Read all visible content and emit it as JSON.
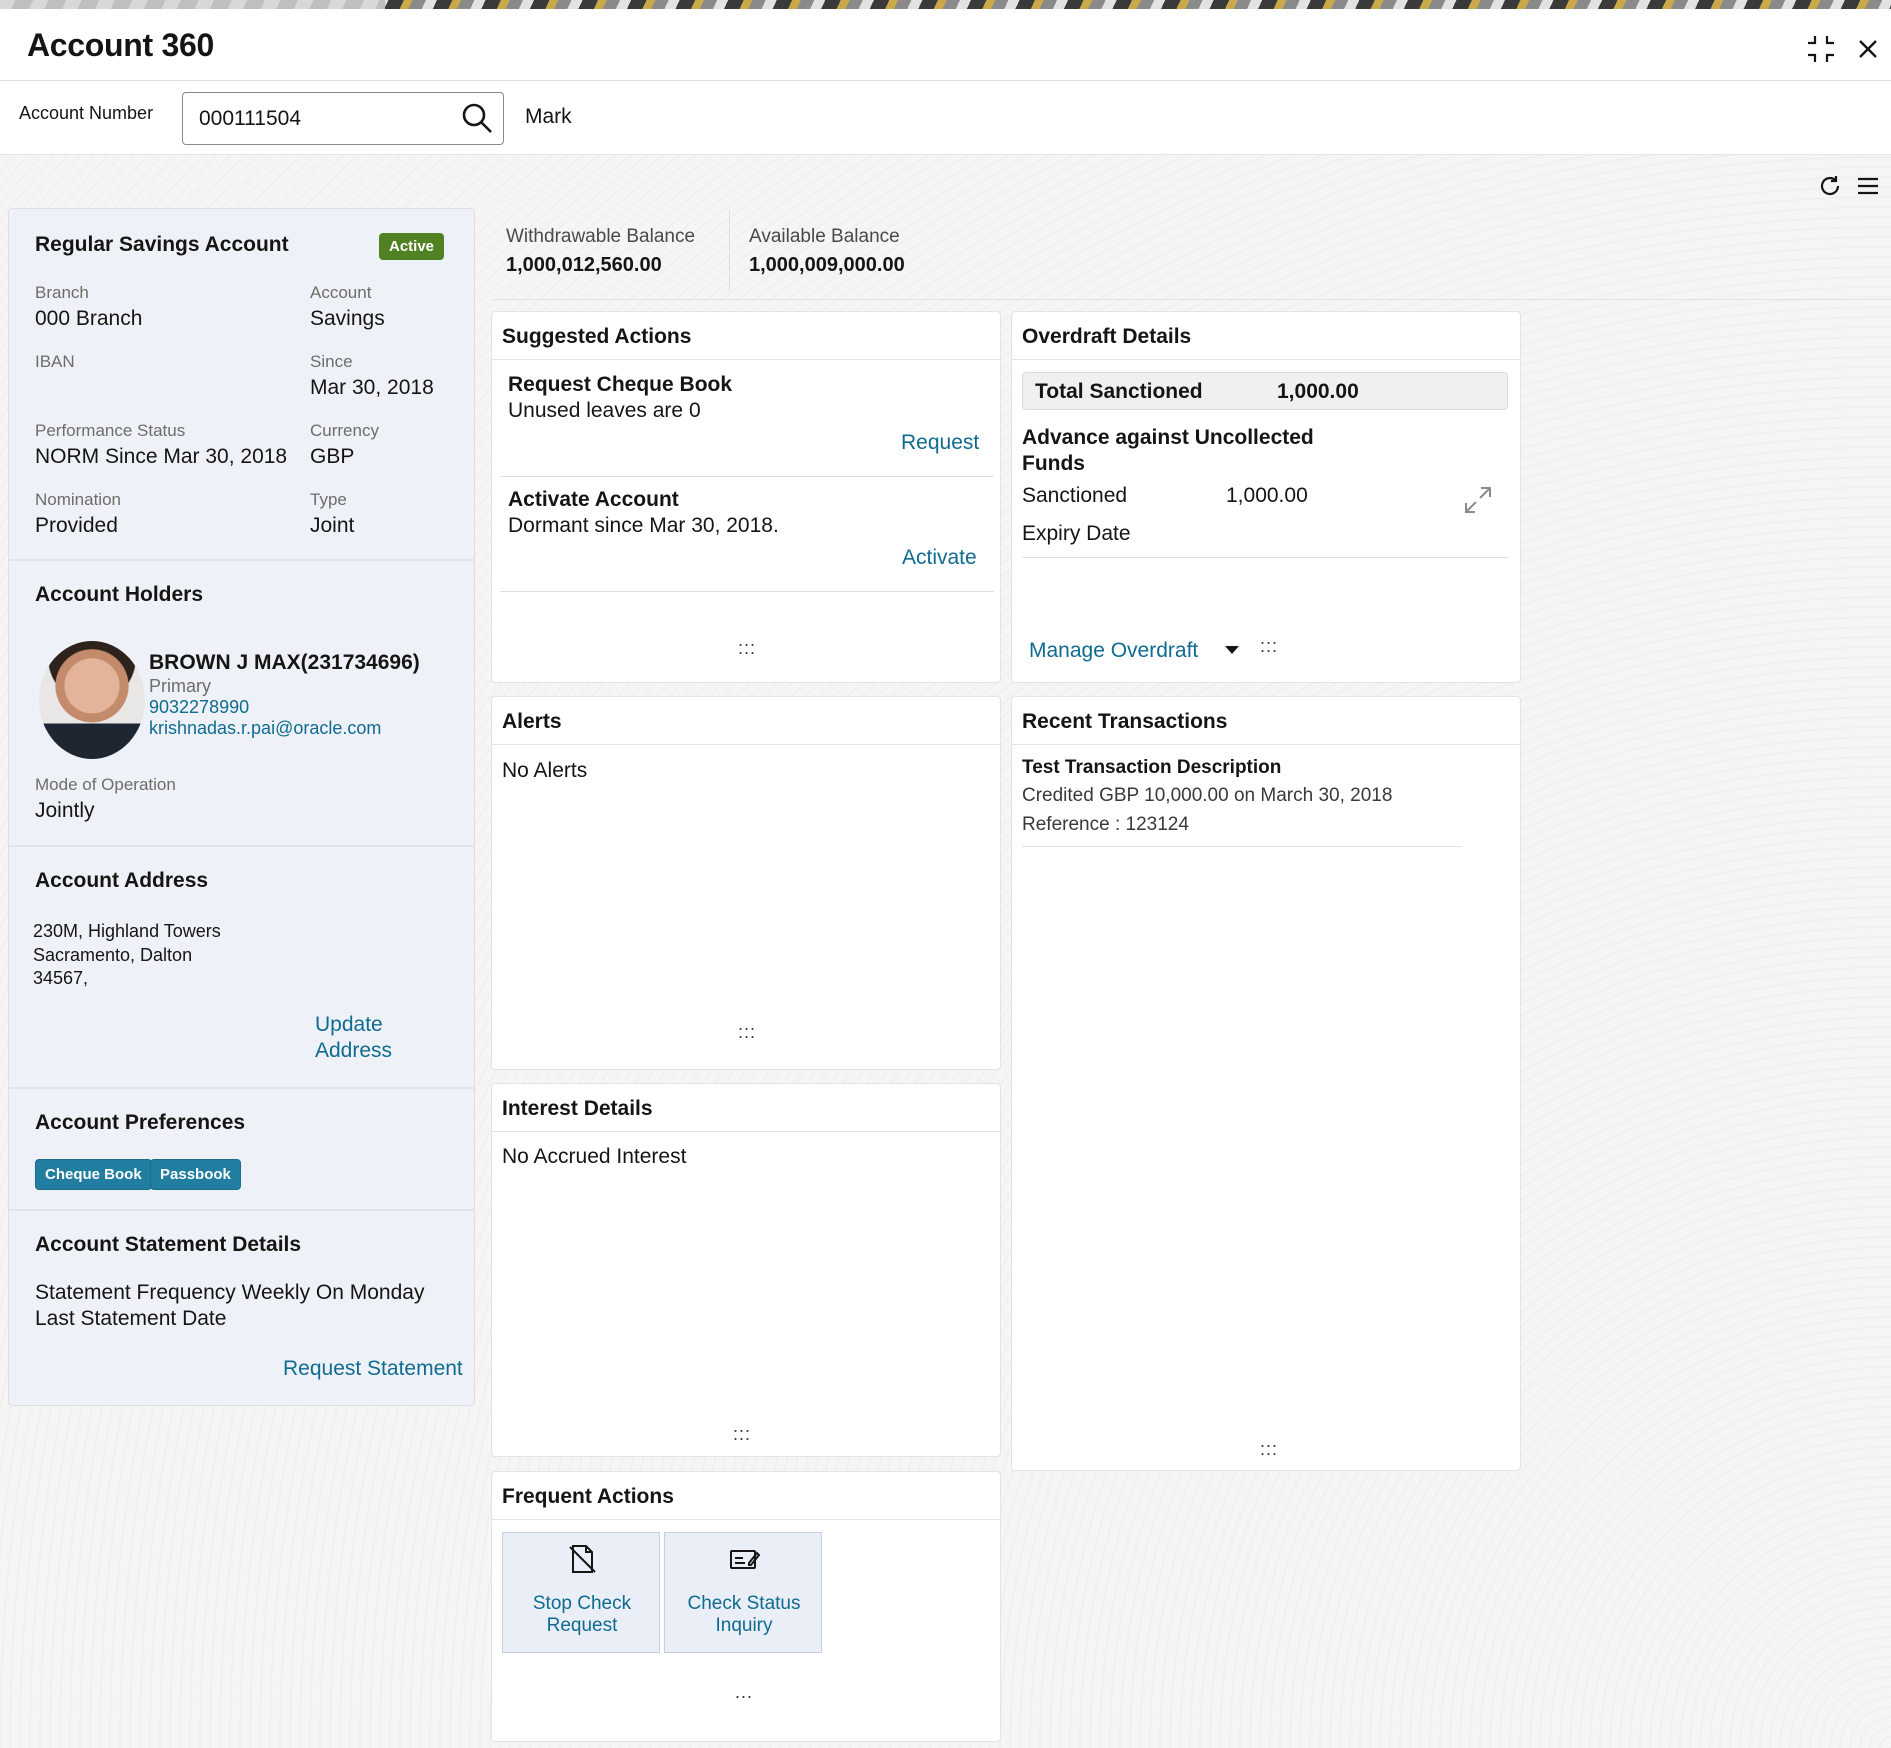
{
  "window": {
    "title": "Account 360"
  },
  "search": {
    "label": "Account Number",
    "value": "000111504",
    "customer_name": "Mark"
  },
  "account": {
    "name": "Regular Savings Account",
    "status": "Active",
    "fields": {
      "branch_label": "Branch",
      "branch_value": "000 Branch",
      "account_label": "Account",
      "account_value": "Savings",
      "iban_label": "IBAN",
      "since_label": "Since",
      "since_value": "Mar 30, 2018",
      "perf_label": "Performance Status",
      "perf_value": "NORM Since Mar 30, 2018",
      "currency_label": "Currency",
      "currency_value": "GBP",
      "nomination_label": "Nomination",
      "nomination_value": "Provided",
      "type_label": "Type",
      "type_value": "Joint"
    }
  },
  "holders": {
    "title": "Account Holders",
    "name": "BROWN J MAX(231734696)",
    "role": "Primary",
    "phone": "9032278990",
    "email": "krishnadas.r.pai@oracle.com",
    "mode_label": "Mode of Operation",
    "mode_value": "Jointly"
  },
  "address": {
    "title": "Account Address",
    "line1": "230M, Highland Towers",
    "line2": "Sacramento, Dalton",
    "line3": "34567,",
    "update_line1": "Update",
    "update_line2": "Address"
  },
  "preferences": {
    "title": "Account Preferences",
    "chips": [
      "Cheque Book",
      "Passbook"
    ]
  },
  "statement": {
    "title": "Account Statement Details",
    "frequency": "Statement Frequency Weekly On Monday",
    "last_date": "Last Statement Date",
    "request": "Request Statement"
  },
  "balances": {
    "withdrawable_label": "Withdrawable Balance",
    "withdrawable_value": "1,000,012,560.00",
    "available_label": "Available Balance",
    "available_value": "1,000,009,000.00"
  },
  "suggested": {
    "title": "Suggested Actions",
    "items": [
      {
        "title": "Request Cheque Book",
        "sub": "Unused leaves are 0",
        "action": "Request"
      },
      {
        "title": "Activate Account",
        "sub": "Dormant since Mar 30, 2018.",
        "action": "Activate"
      }
    ],
    "drag": ":::"
  },
  "overdraft": {
    "title": "Overdraft Details",
    "total_label": "Total Sanctioned",
    "total_value": "1,000.00",
    "advance_line1": "Advance against Uncollected",
    "advance_line2": "Funds",
    "sanctioned_label": "Sanctioned",
    "sanctioned_value": "1,000.00",
    "expiry_label": "Expiry Date",
    "manage": "Manage Overdraft",
    "drag": ":::"
  },
  "alerts": {
    "title": "Alerts",
    "text": "No Alerts",
    "drag": ":::"
  },
  "transactions": {
    "title": "Recent Transactions",
    "items": [
      {
        "desc": "Test Transaction Description",
        "detail": "Credited GBP 10,000.00 on March 30, 2018",
        "ref": "Reference : 123124"
      }
    ],
    "drag": ":::"
  },
  "interest": {
    "title": "Interest Details",
    "text": "No Accrued Interest",
    "drag": ":::"
  },
  "frequent": {
    "title": "Frequent Actions",
    "tiles": [
      {
        "line1": "Stop Check",
        "line2": "Request",
        "icon": "stop-check-icon"
      },
      {
        "line1": "Check Status",
        "line2": "Inquiry",
        "icon": "check-status-icon"
      }
    ],
    "more": "..."
  },
  "colors": {
    "active": "#508223",
    "link": "#0f6b8f",
    "chip": "#227ea0"
  }
}
